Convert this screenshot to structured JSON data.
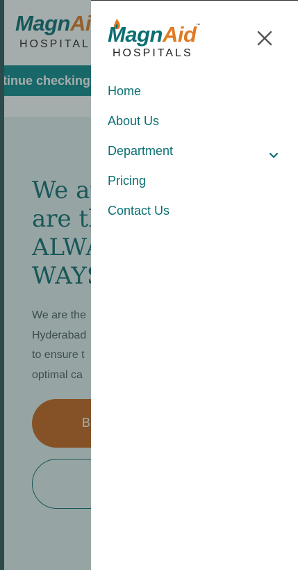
{
  "brand": {
    "name_part1": "Magn",
    "name_part2": "Aid",
    "trademark": "™",
    "subtitle": "HOSPITALS"
  },
  "background_page": {
    "marquee_text": "tinue checking",
    "hero_title_lines": [
      "We at",
      "are th",
      "ALWA",
      "WAYS"
    ],
    "hero_text_lines": [
      "We are the",
      "Hyderabad",
      "to ensure t",
      "optimal ca"
    ],
    "primary_button_label": "B"
  },
  "menu": {
    "close_icon": "close-icon",
    "items": [
      {
        "label": "Home"
      },
      {
        "label": "About Us"
      },
      {
        "label": "Department",
        "has_submenu": true
      },
      {
        "label": "Pricing"
      },
      {
        "label": "Contact Us"
      }
    ]
  },
  "colors": {
    "brand_teal": "#0a6f72",
    "brand_orange": "#e07a22",
    "button_orange": "#c8651a",
    "marquee_teal": "#0e8a8c"
  }
}
